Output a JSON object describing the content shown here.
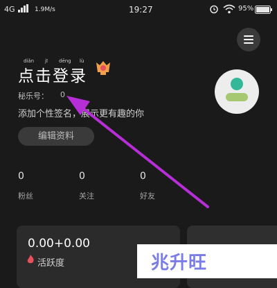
{
  "status_bar": {
    "network": "4G",
    "speed": "1.9M/s",
    "time": "19:27",
    "battery_percent": "95%"
  },
  "profile": {
    "login_title": "点击登录",
    "login_pinyin": [
      "diǎn",
      "jī",
      "dēng",
      "lù"
    ],
    "user_id_label": "秘乐号：",
    "user_id_value": "0",
    "signature": "添加个性签名，展示更有趣的你",
    "edit_button": "编辑资料"
  },
  "stats": [
    {
      "value": "0",
      "label": "粉丝"
    },
    {
      "value": "0",
      "label": "关注"
    },
    {
      "value": "0",
      "label": "好友"
    }
  ],
  "activity_card": {
    "value": "0.00+0.00",
    "label": "活跃度"
  },
  "watermark": "兆升旺",
  "colors": {
    "background": "#1a1a1a",
    "arrow": "#b62fd6",
    "avatar_head": "#34b89a",
    "avatar_body": "#a6c870",
    "flame": "#e8505b",
    "watermark": "#7a7ce6"
  }
}
